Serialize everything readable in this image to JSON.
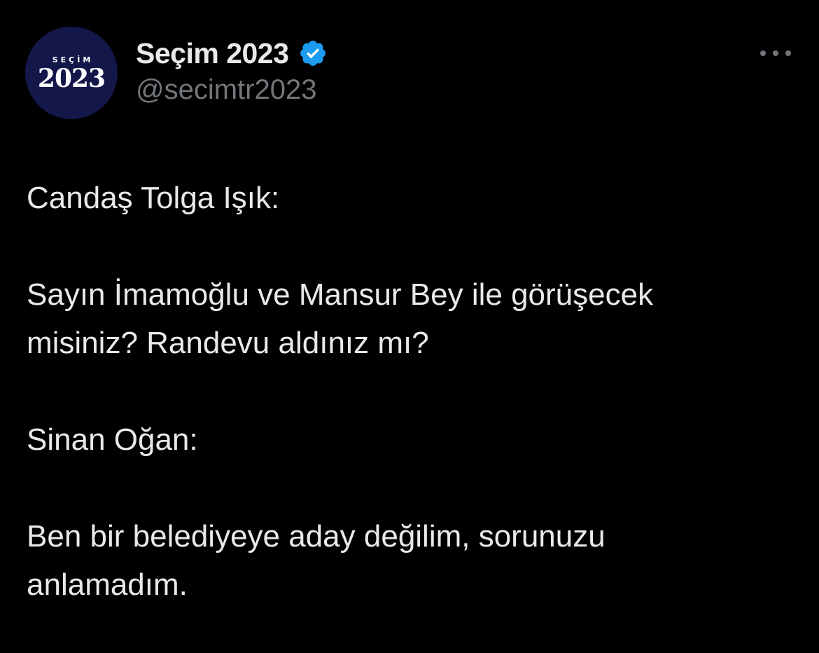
{
  "account": {
    "avatar_small_text": "SEÇİM",
    "avatar_big_text": "2023",
    "display_name": "Seçim 2023",
    "handle": "@secimtr2023",
    "verified_icon": "verified-badge-icon",
    "verified_color": "#1d9bf0"
  },
  "more_menu_icon": "more-horizontal-icon",
  "tweet": {
    "line1": "Candaş Tolga Işık:",
    "line2": "Sayın İmamoğlu ve Mansur Bey ile görüşecek",
    "line3": "misiniz? Randevu aldınız mı?",
    "line4": "Sinan Oğan:",
    "line5": "Ben bir belediyeye aday değilim, sorunuzu",
    "line6": "anlamadım."
  },
  "colors": {
    "background": "#000000",
    "text": "#e7e9ea",
    "secondary": "#71767b",
    "avatar_bg": "#13174a"
  }
}
